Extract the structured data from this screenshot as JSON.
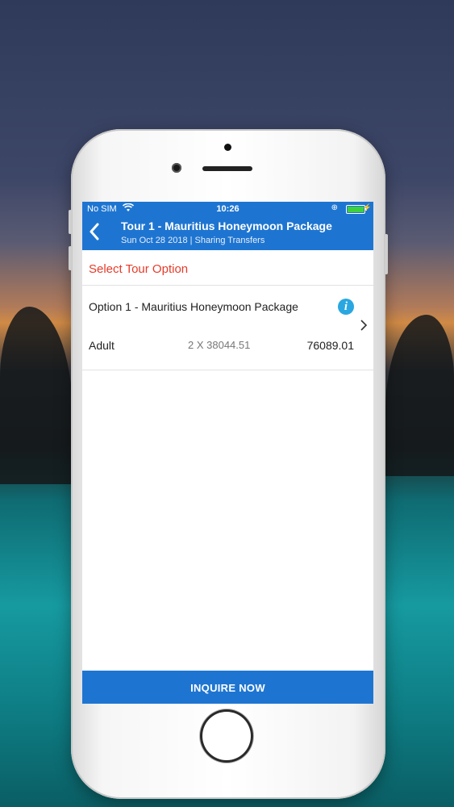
{
  "status_bar": {
    "carrier": "No SIM",
    "time": "10:26",
    "wifi_icon": "wifi-icon",
    "battery_color": "#3dd13d"
  },
  "header": {
    "title": "Tour 1 - Mauritius Honeymoon Package",
    "subtitle": "Sun Oct 28 2018 | Sharing Transfers",
    "back_icon": "chevron-left-icon",
    "color": "#1e75d1"
  },
  "section": {
    "title": "Select Tour Option",
    "title_color": "#e53b2a"
  },
  "option": {
    "name": "Option 1 - Mauritius Honeymoon Package",
    "info_icon": "info-icon",
    "pax_type": "Adult",
    "calc": "2 X 38044.51",
    "total": "76089.01"
  },
  "footer": {
    "inquire_label": "INQUIRE NOW"
  }
}
